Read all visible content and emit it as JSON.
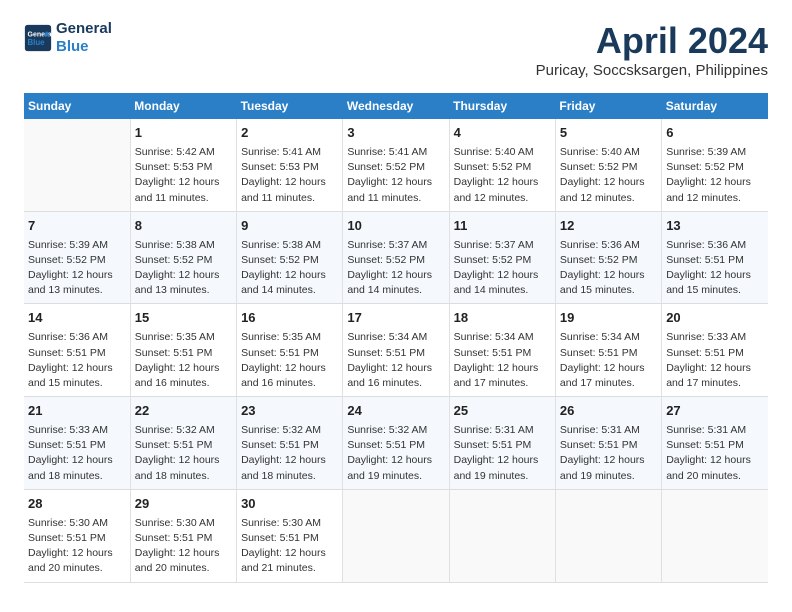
{
  "header": {
    "logo_line1": "General",
    "logo_line2": "Blue",
    "month_title": "April 2024",
    "location": "Puricay, Soccsksargen, Philippines"
  },
  "weekdays": [
    "Sunday",
    "Monday",
    "Tuesday",
    "Wednesday",
    "Thursday",
    "Friday",
    "Saturday"
  ],
  "weeks": [
    [
      {
        "num": "",
        "info": ""
      },
      {
        "num": "1",
        "info": "Sunrise: 5:42 AM\nSunset: 5:53 PM\nDaylight: 12 hours\nand 11 minutes."
      },
      {
        "num": "2",
        "info": "Sunrise: 5:41 AM\nSunset: 5:53 PM\nDaylight: 12 hours\nand 11 minutes."
      },
      {
        "num": "3",
        "info": "Sunrise: 5:41 AM\nSunset: 5:52 PM\nDaylight: 12 hours\nand 11 minutes."
      },
      {
        "num": "4",
        "info": "Sunrise: 5:40 AM\nSunset: 5:52 PM\nDaylight: 12 hours\nand 12 minutes."
      },
      {
        "num": "5",
        "info": "Sunrise: 5:40 AM\nSunset: 5:52 PM\nDaylight: 12 hours\nand 12 minutes."
      },
      {
        "num": "6",
        "info": "Sunrise: 5:39 AM\nSunset: 5:52 PM\nDaylight: 12 hours\nand 12 minutes."
      }
    ],
    [
      {
        "num": "7",
        "info": "Sunrise: 5:39 AM\nSunset: 5:52 PM\nDaylight: 12 hours\nand 13 minutes."
      },
      {
        "num": "8",
        "info": "Sunrise: 5:38 AM\nSunset: 5:52 PM\nDaylight: 12 hours\nand 13 minutes."
      },
      {
        "num": "9",
        "info": "Sunrise: 5:38 AM\nSunset: 5:52 PM\nDaylight: 12 hours\nand 14 minutes."
      },
      {
        "num": "10",
        "info": "Sunrise: 5:37 AM\nSunset: 5:52 PM\nDaylight: 12 hours\nand 14 minutes."
      },
      {
        "num": "11",
        "info": "Sunrise: 5:37 AM\nSunset: 5:52 PM\nDaylight: 12 hours\nand 14 minutes."
      },
      {
        "num": "12",
        "info": "Sunrise: 5:36 AM\nSunset: 5:52 PM\nDaylight: 12 hours\nand 15 minutes."
      },
      {
        "num": "13",
        "info": "Sunrise: 5:36 AM\nSunset: 5:51 PM\nDaylight: 12 hours\nand 15 minutes."
      }
    ],
    [
      {
        "num": "14",
        "info": "Sunrise: 5:36 AM\nSunset: 5:51 PM\nDaylight: 12 hours\nand 15 minutes."
      },
      {
        "num": "15",
        "info": "Sunrise: 5:35 AM\nSunset: 5:51 PM\nDaylight: 12 hours\nand 16 minutes."
      },
      {
        "num": "16",
        "info": "Sunrise: 5:35 AM\nSunset: 5:51 PM\nDaylight: 12 hours\nand 16 minutes."
      },
      {
        "num": "17",
        "info": "Sunrise: 5:34 AM\nSunset: 5:51 PM\nDaylight: 12 hours\nand 16 minutes."
      },
      {
        "num": "18",
        "info": "Sunrise: 5:34 AM\nSunset: 5:51 PM\nDaylight: 12 hours\nand 17 minutes."
      },
      {
        "num": "19",
        "info": "Sunrise: 5:34 AM\nSunset: 5:51 PM\nDaylight: 12 hours\nand 17 minutes."
      },
      {
        "num": "20",
        "info": "Sunrise: 5:33 AM\nSunset: 5:51 PM\nDaylight: 12 hours\nand 17 minutes."
      }
    ],
    [
      {
        "num": "21",
        "info": "Sunrise: 5:33 AM\nSunset: 5:51 PM\nDaylight: 12 hours\nand 18 minutes."
      },
      {
        "num": "22",
        "info": "Sunrise: 5:32 AM\nSunset: 5:51 PM\nDaylight: 12 hours\nand 18 minutes."
      },
      {
        "num": "23",
        "info": "Sunrise: 5:32 AM\nSunset: 5:51 PM\nDaylight: 12 hours\nand 18 minutes."
      },
      {
        "num": "24",
        "info": "Sunrise: 5:32 AM\nSunset: 5:51 PM\nDaylight: 12 hours\nand 19 minutes."
      },
      {
        "num": "25",
        "info": "Sunrise: 5:31 AM\nSunset: 5:51 PM\nDaylight: 12 hours\nand 19 minutes."
      },
      {
        "num": "26",
        "info": "Sunrise: 5:31 AM\nSunset: 5:51 PM\nDaylight: 12 hours\nand 19 minutes."
      },
      {
        "num": "27",
        "info": "Sunrise: 5:31 AM\nSunset: 5:51 PM\nDaylight: 12 hours\nand 20 minutes."
      }
    ],
    [
      {
        "num": "28",
        "info": "Sunrise: 5:30 AM\nSunset: 5:51 PM\nDaylight: 12 hours\nand 20 minutes."
      },
      {
        "num": "29",
        "info": "Sunrise: 5:30 AM\nSunset: 5:51 PM\nDaylight: 12 hours\nand 20 minutes."
      },
      {
        "num": "30",
        "info": "Sunrise: 5:30 AM\nSunset: 5:51 PM\nDaylight: 12 hours\nand 21 minutes."
      },
      {
        "num": "",
        "info": ""
      },
      {
        "num": "",
        "info": ""
      },
      {
        "num": "",
        "info": ""
      },
      {
        "num": "",
        "info": ""
      }
    ]
  ]
}
